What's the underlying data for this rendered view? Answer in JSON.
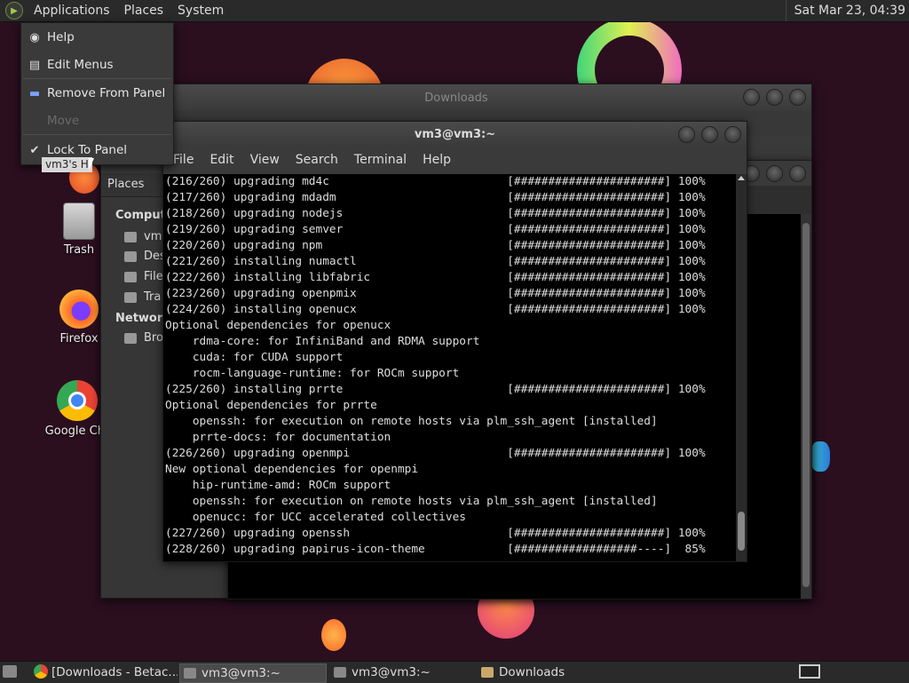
{
  "top_panel": {
    "menus": [
      "Applications",
      "Places",
      "System"
    ],
    "clock": "Sat Mar 23, 04:39"
  },
  "dropdown_menu": {
    "items": [
      {
        "label": "Help",
        "icon": "help-lifebuoy-icon",
        "enabled": true
      },
      {
        "label": "Edit Menus",
        "icon": "edit-menus-icon",
        "enabled": true
      },
      {
        "label": "Remove From Panel",
        "icon": "remove-icon",
        "enabled": true
      },
      {
        "label": "Move",
        "icon": "",
        "enabled": false
      },
      {
        "label": "Lock To Panel",
        "icon": "checkmark-icon",
        "enabled": true,
        "checked": true
      }
    ],
    "tooltip": "vm3's H"
  },
  "desktop_icons": [
    {
      "label": "Trash",
      "icon": "trash-icon"
    },
    {
      "label": "Firefox",
      "icon": "firefox-icon"
    },
    {
      "label": "Google Chr",
      "icon": "chrome-icon"
    }
  ],
  "downloads_window": {
    "title": "Downloads",
    "places_header": "Places",
    "places": [
      {
        "label": "Compute",
        "type": "section"
      },
      {
        "label": "vm",
        "type": "item",
        "icon": "home-folder-icon"
      },
      {
        "label": "Des",
        "type": "item",
        "icon": "desktop-folder-icon"
      },
      {
        "label": "File",
        "type": "item",
        "icon": "filesystem-icon"
      },
      {
        "label": "Tra",
        "type": "item",
        "icon": "trash-icon"
      },
      {
        "label": "Network",
        "type": "section"
      },
      {
        "label": "Bro",
        "type": "item",
        "icon": "network-browse-icon"
      }
    ]
  },
  "terminal": {
    "title": "vm3@vm3:~",
    "menu": [
      "File",
      "Edit",
      "View",
      "Search",
      "Terminal",
      "Help"
    ],
    "lines": [
      "(216/260) upgrading md4c                          [######################] 100%",
      "(217/260) upgrading mdadm                         [######################] 100%",
      "(218/260) upgrading nodejs                        [######################] 100%",
      "(219/260) upgrading semver                        [######################] 100%",
      "(220/260) upgrading npm                           [######################] 100%",
      "(221/260) installing numactl                      [######################] 100%",
      "(222/260) installing libfabric                    [######################] 100%",
      "(223/260) upgrading openpmix                      [######################] 100%",
      "(224/260) installing openucx                      [######################] 100%",
      "Optional dependencies for openucx",
      "    rdma-core: for InfiniBand and RDMA support",
      "    cuda: for CUDA support",
      "    rocm-language-runtime: for ROCm support",
      "(225/260) installing prrte                        [######################] 100%",
      "Optional dependencies for prrte",
      "    openssh: for execution on remote hosts via plm_ssh_agent [installed]",
      "    prrte-docs: for documentation",
      "(226/260) upgrading openmpi                       [######################] 100%",
      "New optional dependencies for openmpi",
      "    hip-runtime-amd: ROCm support",
      "    openssh: for execution on remote hosts via plm_ssh_agent [installed]",
      "    openucc: for UCC accelerated collectives",
      "(227/260) upgrading openssh                       [######################] 100%",
      "(228/260) upgrading papirus-icon-theme            [##################----]  85%"
    ]
  },
  "taskbar": {
    "tasks": [
      {
        "label": "[Downloads - Betac...",
        "icon": "chrome-icon",
        "active": false
      },
      {
        "label": "vm3@vm3:~",
        "icon": "terminal-icon",
        "active": true
      },
      {
        "label": "vm3@vm3:~",
        "icon": "terminal-icon",
        "active": false
      },
      {
        "label": "Downloads",
        "icon": "folder-icon",
        "active": false
      }
    ]
  }
}
